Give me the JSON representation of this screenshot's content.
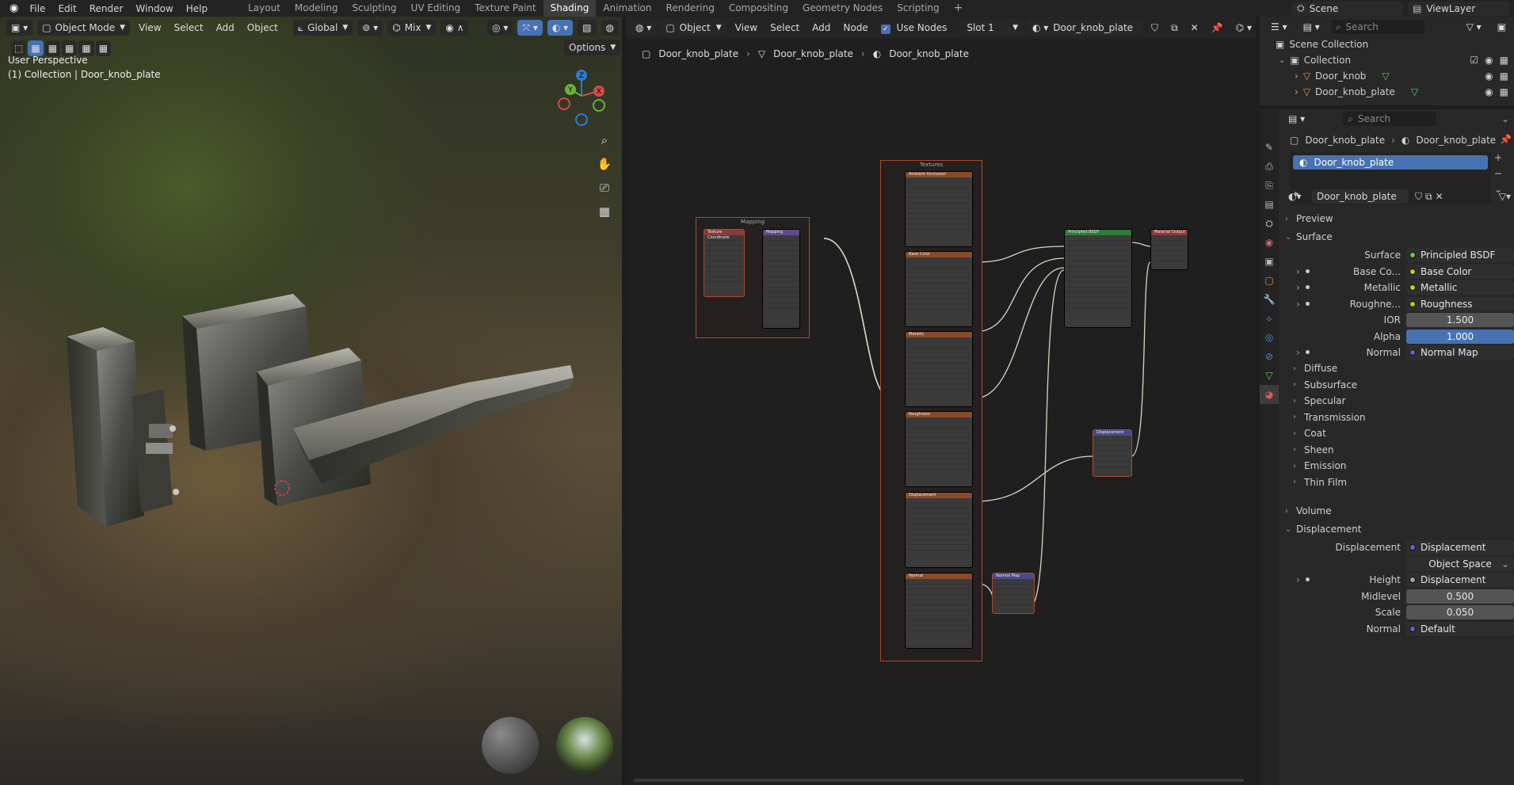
{
  "topbar": {
    "menus": [
      "File",
      "Edit",
      "Render",
      "Window",
      "Help"
    ],
    "workspaces": [
      "Layout",
      "Modeling",
      "Sculpting",
      "UV Editing",
      "Texture Paint",
      "Shading",
      "Animation",
      "Rendering",
      "Compositing",
      "Geometry Nodes",
      "Scripting"
    ],
    "active_workspace": "Shading",
    "add_tab": "+",
    "scene": "Scene",
    "view_layer": "ViewLayer"
  },
  "viewport": {
    "mode": "Object Mode",
    "menus": [
      "View",
      "Select",
      "Add",
      "Object"
    ],
    "transform_orientation": "Global",
    "snap": "Mix",
    "options": "Options",
    "info_line1": "User Perspective",
    "info_line2": "(1) Collection | Door_knob_plate",
    "gizmo": {
      "x": "X",
      "y": "Y",
      "z": "Z"
    }
  },
  "node_editor": {
    "object_dropdown": "Object",
    "menus": [
      "View",
      "Select",
      "Add",
      "Node"
    ],
    "use_nodes": "Use Nodes",
    "slot": "Slot 1",
    "material": "Door_knob_plate",
    "breadcrumb": [
      "Door_knob_plate",
      "Door_knob_plate",
      "Door_knob_plate"
    ],
    "frames": {
      "mapping": "Mapping",
      "textures": "Textures"
    },
    "nodes": {
      "tex_coord": "Texture Coordinate",
      "mapping": "Mapping",
      "tex_ao": "Ambient Occlusion",
      "tex_base": "Base Color",
      "tex_metal": "Metallic",
      "tex_rough": "Roughness",
      "tex_disp": "Displacement",
      "tex_normal": "Normal",
      "principled": "Principled BSDF",
      "output": "Material Output",
      "displacement": "Displacement",
      "normal_map": "Normal Map"
    }
  },
  "outliner": {
    "search_placeholder": "Search",
    "scene_collection": "Scene Collection",
    "collection": "Collection",
    "items": [
      "Door_knob",
      "Door_knob_plate"
    ]
  },
  "properties": {
    "search_placeholder": "Search",
    "breadcrumb_object": "Door_knob_plate",
    "breadcrumb_material": "Door_knob_plate",
    "slot_item": "Door_knob_plate",
    "material_name": "Door_knob_plate",
    "sections": {
      "preview": "Preview",
      "surface": "Surface",
      "volume": "Volume",
      "displacement": "Displacement"
    },
    "surface_rows": [
      {
        "label": "Surface",
        "value": "Principled BSDF",
        "type": "shader",
        "sock": "#63c763"
      },
      {
        "label": "Base Co...",
        "value": "Base Color",
        "type": "shader",
        "sock": "#c7c729",
        "expand": true
      },
      {
        "label": "Metallic",
        "value": "Metallic",
        "type": "shader",
        "sock": "#c7c729",
        "expand": true
      },
      {
        "label": "Roughne...",
        "value": "Roughness",
        "type": "shader",
        "sock": "#c7c729",
        "expand": true
      },
      {
        "label": "IOR",
        "value": "1.500",
        "type": "num",
        "sock": "#a1a1a1"
      },
      {
        "label": "Alpha",
        "value": "1.000",
        "type": "blue",
        "sock": "#a1a1a1"
      },
      {
        "label": "Normal",
        "value": "Normal Map",
        "type": "shader",
        "sock": "#6363c7",
        "expand": true
      }
    ],
    "subpanels": [
      "Diffuse",
      "Subsurface",
      "Specular",
      "Transmission",
      "Coat",
      "Sheen",
      "Emission",
      "Thin Film"
    ],
    "displacement_rows": [
      {
        "label": "Displacement",
        "value": "Displacement",
        "type": "shader",
        "sock": "#6363c7"
      },
      {
        "label": "",
        "value": "Object Space",
        "type": "dropdown"
      },
      {
        "label": "Height",
        "value": "Displacement",
        "type": "shader",
        "sock": "#a1a1a1",
        "expand": true
      },
      {
        "label": "Midlevel",
        "value": "0.500",
        "type": "num",
        "sock": "#a1a1a1"
      },
      {
        "label": "Scale",
        "value": "0.050",
        "type": "num",
        "sock": "#a1a1a1"
      },
      {
        "label": "Normal",
        "value": "Default",
        "type": "shader",
        "sock": "#6363c7"
      }
    ]
  }
}
